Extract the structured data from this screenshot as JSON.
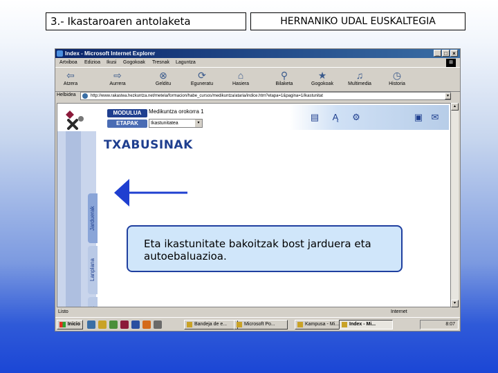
{
  "slide": {
    "header_left": "3.- Ikastaroaren antolaketa",
    "header_right": "HERNANIKO UDAL EUSKALTEGIA"
  },
  "browser": {
    "title": "Index - Microsoft Internet Explorer",
    "menu": [
      "Artxiboa",
      "Edizioa",
      "Ikusi",
      "Gogokoak",
      "Tresnak",
      "Laguntza"
    ],
    "toolbar": [
      "Atzera",
      "Aurrera",
      "Gelditu",
      "Eguneratu",
      "Hasiera",
      "Bilaketa",
      "Gogokoak",
      "Multimedia",
      "Historia"
    ],
    "address_label": "Helbidea",
    "address": "http://www.rakastea.hezkuntza.net/metela/formacion/habe_cursos/medikuntza/ataria/indice.htm?etapa=1&pagina=1/ikastunitat"
  },
  "page": {
    "modulua_label": "MODULUA",
    "modulua_value": "Medikuntza orokorra 1",
    "etapak_label": "ETAPAK",
    "etapak_value": "Ikastunitatea",
    "heading": "TXABUSINAK",
    "side_tabs": [
      "Jarduerak",
      "Lanplana",
      "Edukiak"
    ],
    "callout_text": "Eta ikastunitate bakoitzak bost jarduera eta autoebaluazioa."
  },
  "status": {
    "left": "Listo",
    "right": "Internet"
  },
  "taskbar": {
    "start": "Inicio",
    "tasks": [
      "Bandeja de e...",
      "Microsoft Po...",
      "Kampusa - Mi...",
      "Index - Mi..."
    ],
    "clock": "8:07"
  },
  "colors": {
    "heading": "#1f3f8f",
    "callout_bg": "#d0e6fa",
    "callout_border": "#1f3f9f",
    "arrow": "#1f3fd0"
  }
}
